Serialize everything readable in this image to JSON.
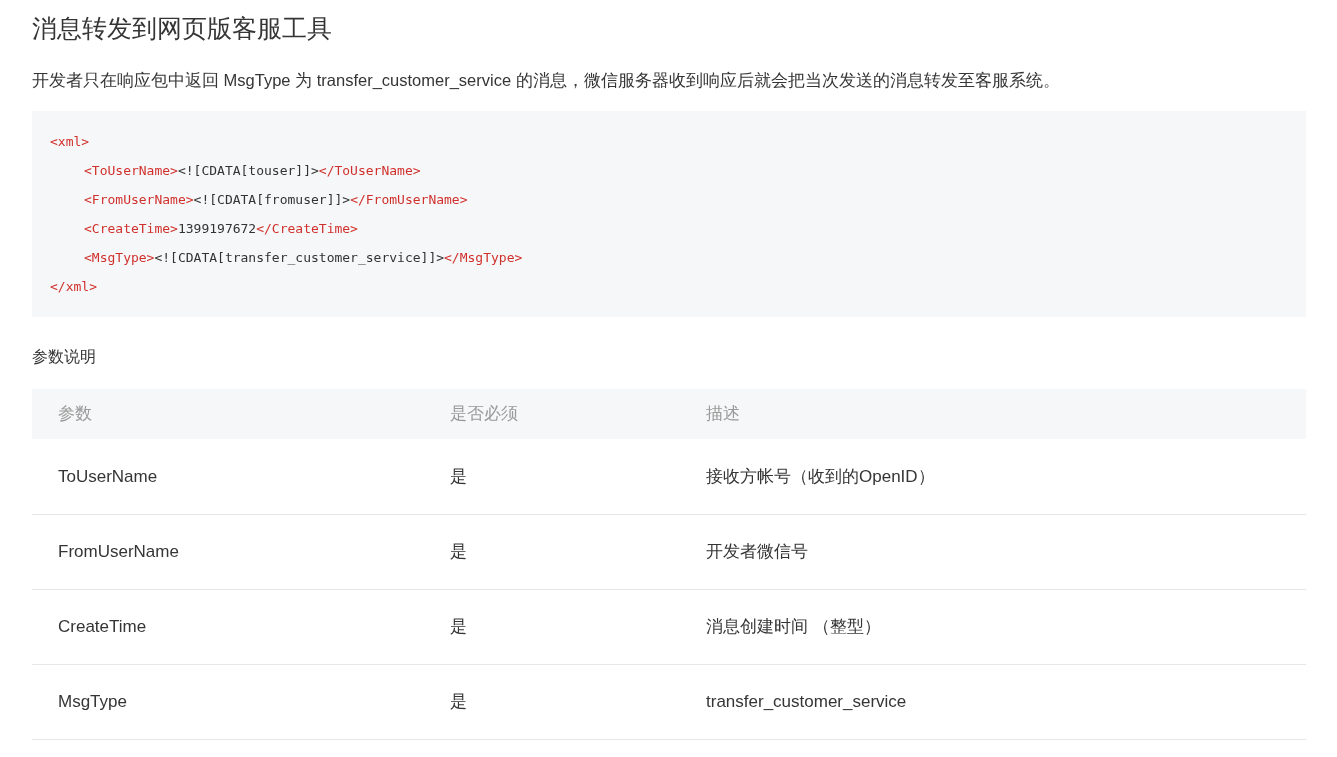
{
  "title": "消息转发到网页版客服工具",
  "description": "开发者只在响应包中返回 MsgType 为 transfer_customer_service 的消息，微信服务器收到响应后就会把当次发送的消息转发至客服系统。",
  "code": {
    "open": [
      {
        "kind": "tag",
        "text": "<xml>"
      }
    ],
    "children": [
      [
        {
          "kind": "tag",
          "text": "<ToUserName>"
        },
        {
          "kind": "text",
          "text": "<![CDATA[touser]]>"
        },
        {
          "kind": "tag",
          "text": "</ToUserName>"
        }
      ],
      [
        {
          "kind": "tag",
          "text": "<FromUserName>"
        },
        {
          "kind": "text",
          "text": "<![CDATA[fromuser]]>"
        },
        {
          "kind": "tag",
          "text": "</FromUserName>"
        }
      ],
      [
        {
          "kind": "tag",
          "text": "<CreateTime>"
        },
        {
          "kind": "text",
          "text": "1399197672"
        },
        {
          "kind": "tag",
          "text": "</CreateTime>"
        }
      ],
      [
        {
          "kind": "tag",
          "text": "<MsgType>"
        },
        {
          "kind": "text",
          "text": "<![CDATA[transfer_customer_service]]>"
        },
        {
          "kind": "tag",
          "text": "</MsgType>"
        }
      ]
    ],
    "close": [
      {
        "kind": "tag",
        "text": "</xml>"
      }
    ]
  },
  "params_heading": "参数说明",
  "table": {
    "columns": [
      "参数",
      "是否必须",
      "描述"
    ],
    "rows": [
      [
        "ToUserName",
        "是",
        "接收方帐号（收到的OpenID）"
      ],
      [
        "FromUserName",
        "是",
        "开发者微信号"
      ],
      [
        "CreateTime",
        "是",
        "消息创建时间 （整型）"
      ],
      [
        "MsgType",
        "是",
        "transfer_customer_service"
      ]
    ]
  }
}
